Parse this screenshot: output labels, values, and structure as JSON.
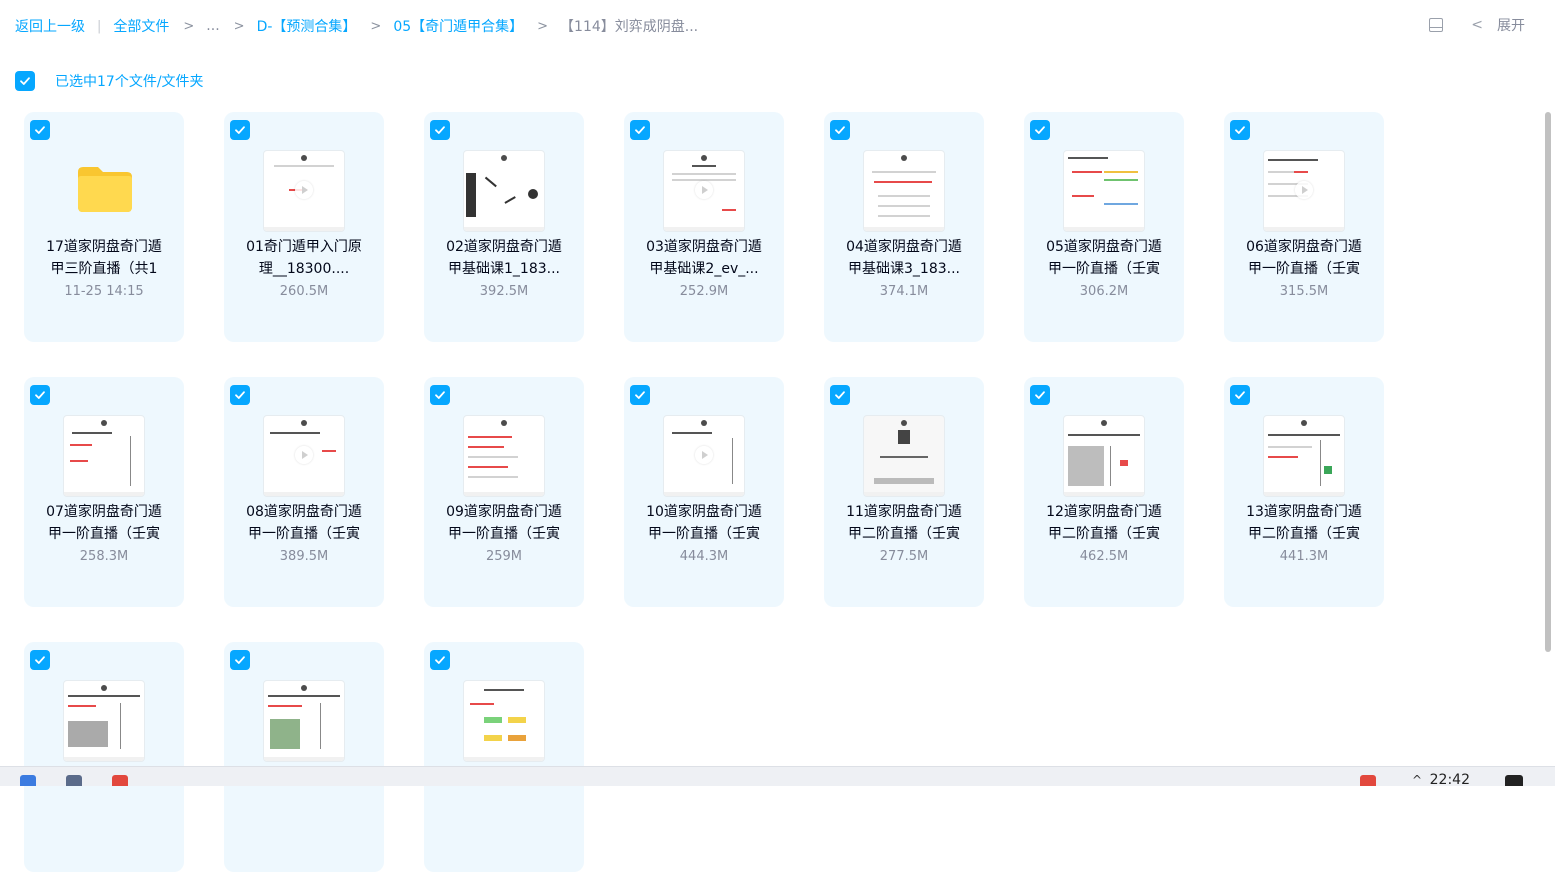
{
  "breadcrumb": {
    "back": "返回上一级",
    "all_files": "全部文件",
    "ellipsis": "...",
    "level1": "D-【预测合集】",
    "level2": "05【奇门遁甲合集】",
    "current": "【114】刘弈成阴盘..."
  },
  "toolbar": {
    "expand_label": "展开"
  },
  "selection": {
    "text": "已选中17个文件/文件夹"
  },
  "files": [
    {
      "line1": "17道家阴盘奇门遁",
      "line2": "甲三阶直播（共1",
      "meta": "11-25 14:15"
    },
    {
      "line1": "01奇门遁甲入门原",
      "line2": "理__18300....",
      "meta": "260.5M"
    },
    {
      "line1": "02道家阴盘奇门遁",
      "line2": "甲基础课1_183...",
      "meta": "392.5M"
    },
    {
      "line1": "03道家阴盘奇门遁",
      "line2": "甲基础课2_ev_...",
      "meta": "252.9M"
    },
    {
      "line1": "04道家阴盘奇门遁",
      "line2": "甲基础课3_183...",
      "meta": "374.1M"
    },
    {
      "line1": "05道家阴盘奇门遁",
      "line2": "甲一阶直播（壬寅",
      "meta": "306.2M"
    },
    {
      "line1": "06道家阴盘奇门遁",
      "line2": "甲一阶直播（壬寅",
      "meta": "315.5M"
    },
    {
      "line1": "07道家阴盘奇门遁",
      "line2": "甲一阶直播（壬寅",
      "meta": "258.3M"
    },
    {
      "line1": "08道家阴盘奇门遁",
      "line2": "甲一阶直播（壬寅",
      "meta": "389.5M"
    },
    {
      "line1": "09道家阴盘奇门遁",
      "line2": "甲一阶直播（壬寅",
      "meta": "259M"
    },
    {
      "line1": "10道家阴盘奇门遁",
      "line2": "甲一阶直播（壬寅",
      "meta": "444.3M"
    },
    {
      "line1": "11道家阴盘奇门遁",
      "line2": "甲二阶直播（壬寅",
      "meta": "277.5M"
    },
    {
      "line1": "12道家阴盘奇门遁",
      "line2": "甲二阶直播（壬寅",
      "meta": "462.5M"
    },
    {
      "line1": "13道家阴盘奇门遁",
      "line2": "甲二阶直播（壬寅",
      "meta": "441.3M"
    },
    {
      "line1": "",
      "line2": "",
      "meta": ""
    },
    {
      "line1": "",
      "line2": "",
      "meta": ""
    },
    {
      "line1": "",
      "line2": "",
      "meta": ""
    }
  ],
  "taskbar": {
    "clock": "22:42"
  },
  "colors": {
    "accent": "#06a7ff",
    "card_bg": "#eef8fe",
    "muted": "#878c9c"
  }
}
